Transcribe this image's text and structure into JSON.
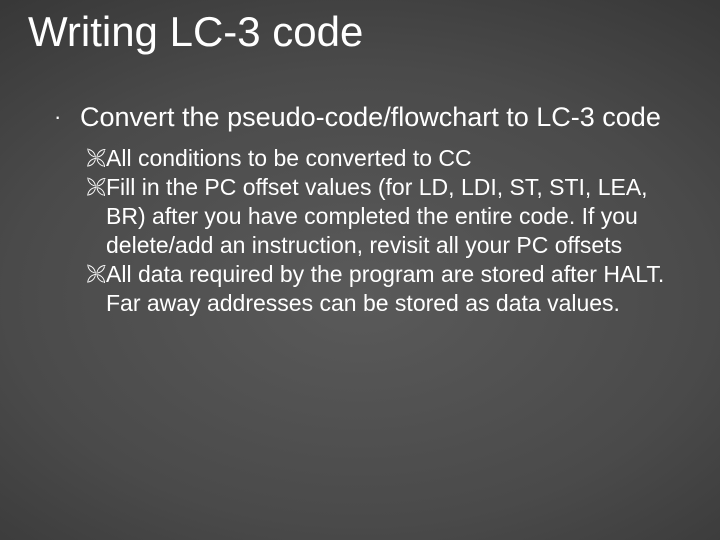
{
  "title": "Writing LC-3 code",
  "level1_bullet": "·",
  "level1_text": "Convert the pseudo-code/flowchart to LC-3 code",
  "level2_bullet": "🙪",
  "sub": {
    "a": "All conditions to be converted to CC",
    "b": "Fill in the PC offset values (for LD, LDI, ST, STI, LEA, BR) after you have completed the entire code. If you delete/add an instruction, revisit all your PC offsets",
    "c": "All data required by the program are stored after HALT. Far away addresses can be stored as data values."
  }
}
